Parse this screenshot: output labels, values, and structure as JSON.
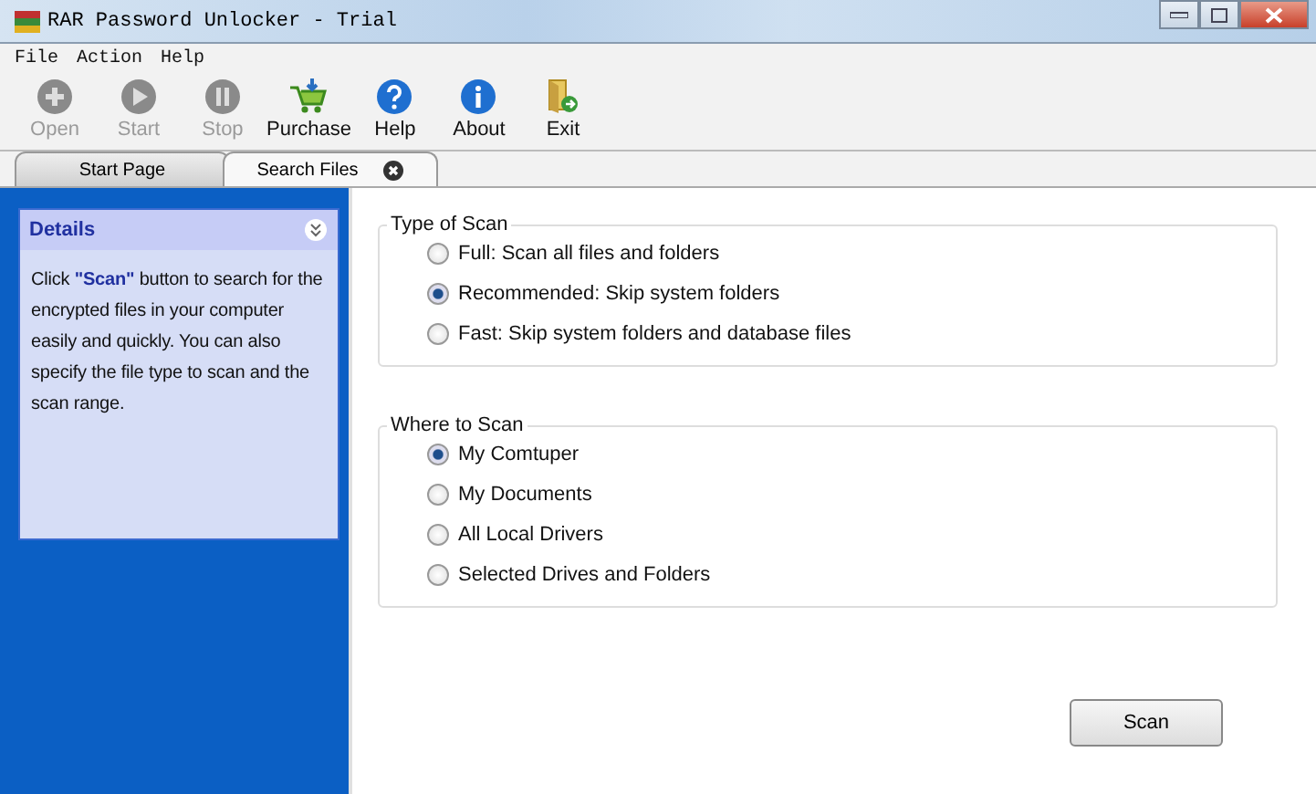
{
  "window": {
    "title": "RAR Password Unlocker - Trial"
  },
  "menu": [
    "File",
    "Action",
    "Help"
  ],
  "toolbar": [
    {
      "kind": "open",
      "label": "Open",
      "disabled": true
    },
    {
      "kind": "start",
      "label": "Start",
      "disabled": true
    },
    {
      "kind": "stop",
      "label": "Stop",
      "disabled": true
    },
    {
      "kind": "purchase",
      "label": "Purchase",
      "disabled": false
    },
    {
      "kind": "help",
      "label": "Help",
      "disabled": false
    },
    {
      "kind": "about",
      "label": "About",
      "disabled": false
    },
    {
      "kind": "exit",
      "label": "Exit",
      "disabled": false
    }
  ],
  "tabs": [
    {
      "label": "Start Page",
      "selected": false,
      "closable": false
    },
    {
      "label": "Search Files",
      "selected": true,
      "closable": true
    }
  ],
  "details": {
    "title": "Details",
    "text": "Click **\"Scan\"**  button to search for the encrypted files in your computer easily and quickly. You can also specify the file type to scan and the scan range."
  },
  "groups": [
    {
      "title": "Type of Scan",
      "options": [
        {
          "label": "Full: Scan all files and folders",
          "selected": false
        },
        {
          "label": "Recommended: Skip system folders",
          "selected": true
        },
        {
          "label": "Fast: Skip system folders and database files",
          "selected": false
        }
      ]
    },
    {
      "title": "Where to Scan",
      "options": [
        {
          "label": "My Comtuper",
          "selected": true
        },
        {
          "label": "My Documents",
          "selected": false
        },
        {
          "label": "All Local Drivers",
          "selected": false
        },
        {
          "label": "Selected Drives and Folders",
          "selected": false
        }
      ]
    }
  ],
  "scan_button": "Scan"
}
